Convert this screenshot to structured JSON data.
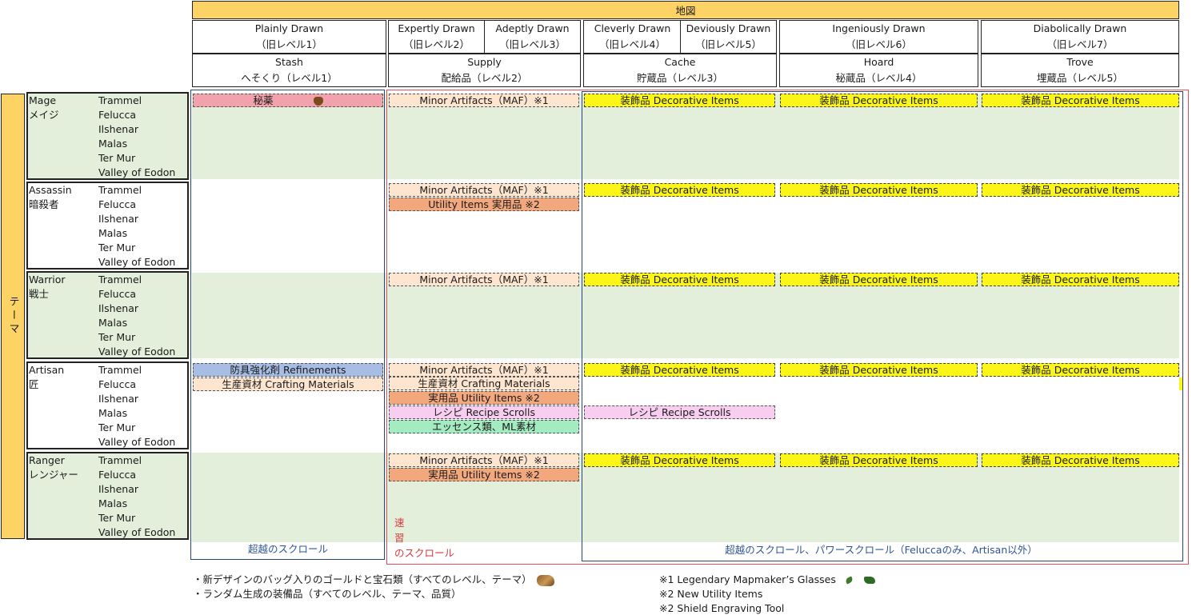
{
  "header": {
    "map_label": "地図",
    "drawn": [
      {
        "name": "Plainly Drawn",
        "old": "（旧レベル1）"
      },
      {
        "name": "Expertly Drawn",
        "old": "（旧レベル2）"
      },
      {
        "name": "Adeptly Drawn",
        "old": "（旧レベル3）"
      },
      {
        "name": "Cleverly Drawn",
        "old": "（旧レベル4）"
      },
      {
        "name": "Deviously Drawn",
        "old": "（旧レベル5）"
      },
      {
        "name": "Ingeniously Drawn",
        "old": "（旧レベル6）"
      },
      {
        "name": "Diabolically Drawn",
        "old": "（旧レベル7）"
      }
    ],
    "levels": [
      {
        "name": "Stash",
        "jp": "へそくり（レベル1）"
      },
      {
        "name": "Supply",
        "jp": "配給品（レベル2）"
      },
      {
        "name": "Cache",
        "jp": "貯蔵品（レベル3）"
      },
      {
        "name": "Hoard",
        "jp": "秘蔵品（レベル4）"
      },
      {
        "name": "Trove",
        "jp": "埋蔵品（レベル5）"
      }
    ]
  },
  "theme_label": "テーマ",
  "facets": [
    "Trammel",
    "Felucca",
    "Ilshenar",
    "Malas",
    "Ter Mur",
    "Valley of Eodon"
  ],
  "themes": [
    {
      "en": "Mage",
      "jp": "メイジ"
    },
    {
      "en": "Assassin",
      "jp": "暗殺者"
    },
    {
      "en": "Warrior",
      "jp": "戦士"
    },
    {
      "en": "Artisan",
      "jp": "匠"
    },
    {
      "en": "Ranger",
      "jp": "レンジャー"
    }
  ],
  "items": {
    "reagents": "秘薬",
    "maf": "Minor Artifacts（MAF）※1",
    "decorative": "装飾品 Decorative Items",
    "utility_en": "Utility Items  実用品 ※2",
    "utility_jp": "実用品 Utility Items ※2",
    "refinements": "防具強化剤 Refinements",
    "crafting": "生産資材 Crafting Materials",
    "recipe": "レシピ  Recipe Scrolls",
    "essence": "エッセンス類、ML素材"
  },
  "scroll_labels": {
    "stash": "超越のスクロール",
    "supply_1": "速",
    "supply_2": "習",
    "supply_3": "のスクロール",
    "high": "超越のスクロール、パワースクロール（Feluccaのみ、Artisan以外）"
  },
  "footnotes": {
    "left_1": "・新デザインのバッグ入りのゴールドと宝石類（すべてのレベル、テーマ）",
    "left_2": "・ランダム生成の装備品（すべてのレベル、テーマ、品質）",
    "right_1": "※1 Legendary Mapmaker’s Glasses",
    "right_2": "※2 New Utility Items",
    "right_3": "※2 Shield Engraving Tool"
  },
  "colors": {
    "header_bar": "#fcd364",
    "green_band": "#e3efdb",
    "decorative": "#fbf617",
    "maf": "#fde5cf",
    "utility": "#f2a77d",
    "recipe": "#f7cdf0",
    "essence": "#a3ebc0",
    "refinements": "#a7bde3",
    "reagents": "#f2a2ad",
    "supply_outline": "#e0505a",
    "cache_outline": "#24467c"
  },
  "icons": [
    "reagent-bag-icon",
    "gold-bag-icon",
    "glasses-icon"
  ]
}
